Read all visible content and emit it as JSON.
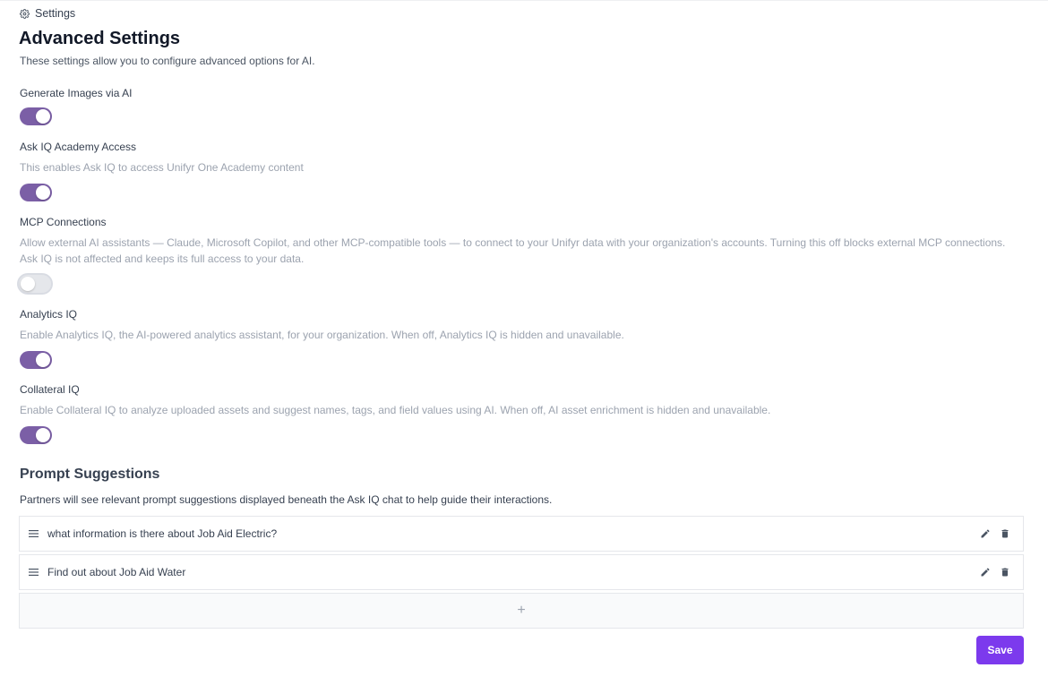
{
  "breadcrumb": {
    "label": "Settings",
    "icon": "gear-icon"
  },
  "page": {
    "title": "Advanced Settings",
    "subtitle": "These settings allow you to configure advanced options for AI."
  },
  "settings": [
    {
      "label": "Generate Images via AI",
      "description": "",
      "enabled": true
    },
    {
      "label": "Ask IQ Academy Access",
      "description": "This enables Ask IQ to access Unifyr One Academy content",
      "enabled": true
    },
    {
      "label": "MCP Connections",
      "description": "Allow external AI assistants — Claude, Microsoft Copilot, and other MCP-compatible tools — to connect to your Unifyr data with your organization's accounts. Turning this off blocks external MCP connections. Ask IQ is not affected and keeps its full access to your data.",
      "enabled": false
    },
    {
      "label": "Analytics IQ",
      "description": "Enable Analytics IQ, the AI-powered analytics assistant, for your organization. When off, Analytics IQ is hidden and unavailable.",
      "enabled": true
    },
    {
      "label": "Collateral IQ",
      "description": "Enable Collateral IQ to analyze uploaded assets and suggest names, tags, and field values using AI. When off, AI asset enrichment is hidden and unavailable.",
      "enabled": true
    }
  ],
  "prompt_suggestions": {
    "title": "Prompt Suggestions",
    "description": "Partners will see relevant prompt suggestions displayed beneath the Ask IQ chat to help guide their interactions.",
    "items": [
      {
        "text": "what information is there about Job Aid Electric?"
      },
      {
        "text": "Find out about Job Aid Water"
      }
    ],
    "add_label": "+"
  },
  "actions": {
    "save_label": "Save"
  },
  "colors": {
    "toggle_on": "#7b5fa6",
    "toggle_off": "#e5e7eb",
    "save_button": "#7c3aed"
  }
}
